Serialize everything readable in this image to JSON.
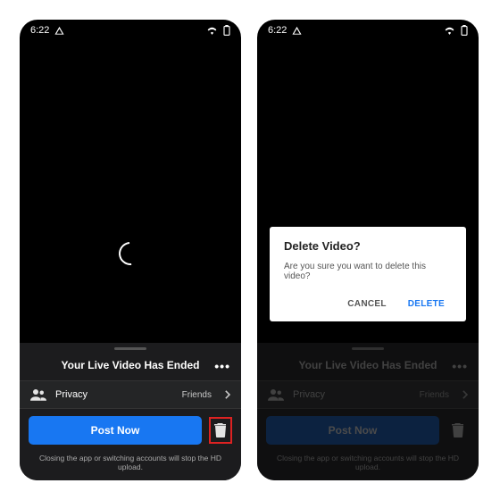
{
  "status": {
    "time": "6:22"
  },
  "sheet": {
    "title": "Your Live Video Has Ended",
    "privacy_label": "Privacy",
    "privacy_value": "Friends",
    "post_label": "Post Now",
    "footer": "Closing the app or switching accounts will stop the HD upload."
  },
  "dialog": {
    "title": "Delete Video?",
    "message": "Are you sure you want to delete this video?",
    "cancel": "CANCEL",
    "delete": "DELETE"
  }
}
